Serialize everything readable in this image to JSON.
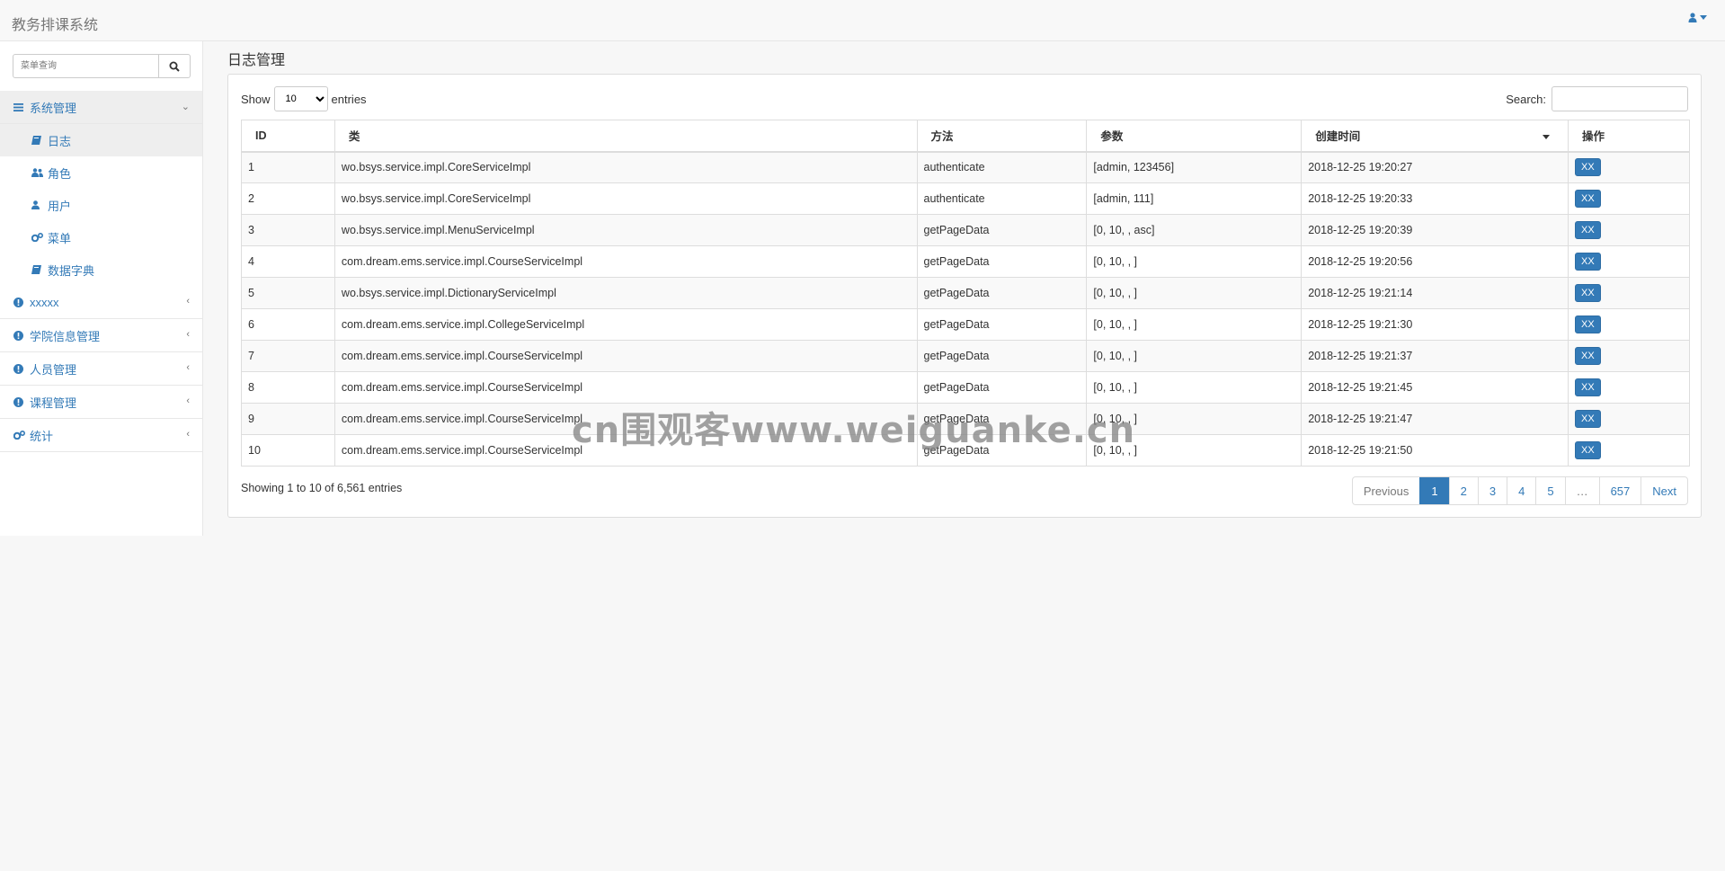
{
  "app": {
    "title": "教务排课系统"
  },
  "sidebar": {
    "search_placeholder": "菜单查询",
    "groups": [
      {
        "label": "系统管理",
        "icon": "bars-icon",
        "expanded": true,
        "items": [
          {
            "label": "日志",
            "icon": "book-icon"
          },
          {
            "label": "角色",
            "icon": "users-icon"
          },
          {
            "label": "用户",
            "icon": "user-icon"
          },
          {
            "label": "菜单",
            "icon": "cogs-icon"
          },
          {
            "label": "数据字典",
            "icon": "book-icon"
          }
        ]
      },
      {
        "label": "xxxxx",
        "icon": "info-circle-icon"
      },
      {
        "label": "学院信息管理",
        "icon": "info-circle-icon"
      },
      {
        "label": "人员管理",
        "icon": "info-circle-icon"
      },
      {
        "label": "课程管理",
        "icon": "info-circle-icon"
      },
      {
        "label": "统计",
        "icon": "cogs-icon"
      }
    ]
  },
  "main": {
    "page_title": "日志管理",
    "length_prefix": "Show",
    "length_value": "10",
    "length_suffix": "entries",
    "search_label": "Search:",
    "columns": [
      "ID",
      "类",
      "方法",
      "参数",
      "创建时间",
      "操作"
    ],
    "rows": [
      {
        "id": "1",
        "cls": "wo.bsys.service.impl.CoreServiceImpl",
        "method": "authenticate",
        "params": "[admin, 123456]",
        "time": "2018-12-25 19:20:27",
        "action": "XX"
      },
      {
        "id": "2",
        "cls": "wo.bsys.service.impl.CoreServiceImpl",
        "method": "authenticate",
        "params": "[admin, 111]",
        "time": "2018-12-25 19:20:33",
        "action": "XX"
      },
      {
        "id": "3",
        "cls": "wo.bsys.service.impl.MenuServiceImpl",
        "method": "getPageData",
        "params": "[0, 10, , asc]",
        "time": "2018-12-25 19:20:39",
        "action": "XX"
      },
      {
        "id": "4",
        "cls": "com.dream.ems.service.impl.CourseServiceImpl",
        "method": "getPageData",
        "params": "[0, 10, , ]",
        "time": "2018-12-25 19:20:56",
        "action": "XX"
      },
      {
        "id": "5",
        "cls": "wo.bsys.service.impl.DictionaryServiceImpl",
        "method": "getPageData",
        "params": "[0, 10, , ]",
        "time": "2018-12-25 19:21:14",
        "action": "XX"
      },
      {
        "id": "6",
        "cls": "com.dream.ems.service.impl.CollegeServiceImpl",
        "method": "getPageData",
        "params": "[0, 10, , ]",
        "time": "2018-12-25 19:21:30",
        "action": "XX"
      },
      {
        "id": "7",
        "cls": "com.dream.ems.service.impl.CourseServiceImpl",
        "method": "getPageData",
        "params": "[0, 10, , ]",
        "time": "2018-12-25 19:21:37",
        "action": "XX"
      },
      {
        "id": "8",
        "cls": "com.dream.ems.service.impl.CourseServiceImpl",
        "method": "getPageData",
        "params": "[0, 10, , ]",
        "time": "2018-12-25 19:21:45",
        "action": "XX"
      },
      {
        "id": "9",
        "cls": "com.dream.ems.service.impl.CourseServiceImpl",
        "method": "getPageData",
        "params": "[0, 10, , ]",
        "time": "2018-12-25 19:21:47",
        "action": "XX"
      },
      {
        "id": "10",
        "cls": "com.dream.ems.service.impl.CourseServiceImpl",
        "method": "getPageData",
        "params": "[0, 10, , ]",
        "time": "2018-12-25 19:21:50",
        "action": "XX"
      }
    ],
    "info_text": "Showing 1 to 10 of 6,561 entries",
    "pagination": {
      "previous": "Previous",
      "pages": [
        "1",
        "2",
        "3",
        "4",
        "5",
        "…",
        "657"
      ],
      "active_page": "1",
      "next": "Next"
    }
  },
  "watermark": "cn围观客www.weiguanke.cn",
  "colors": {
    "accent": "#337ab7",
    "navbar_bg": "#f8f8f8",
    "page_bg": "#f7f7f7"
  }
}
